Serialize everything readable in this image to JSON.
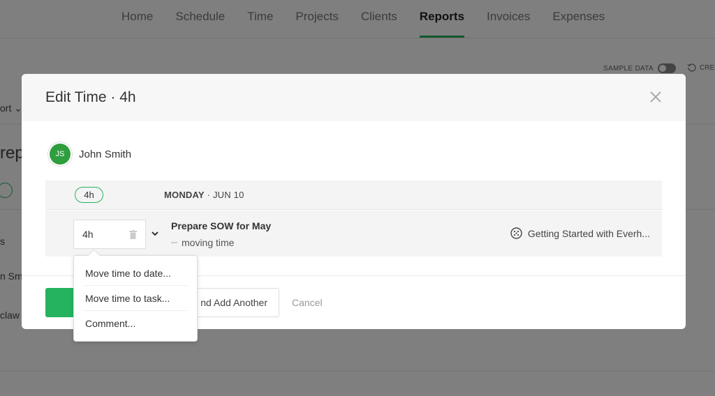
{
  "background": {
    "nav": [
      "Home",
      "Schedule",
      "Time",
      "Projects",
      "Clients",
      "Reports",
      "Invoices",
      "Expenses"
    ],
    "active_nav": "Reports",
    "sample_data_label": "SAMPLE DATA",
    "cre_label": "CRE",
    "sort_label": "ort",
    "heading_fragment": "rep",
    "col_fragment": "s",
    "row1_fragment": "n Sm",
    "row2_fragment": "claw"
  },
  "modal": {
    "title": "Edit Time · 4h",
    "user": {
      "initials": "JS",
      "name": "John Smith"
    },
    "day": {
      "hours": "4h",
      "weekday": "MONDAY",
      "date": "· JUN 10"
    },
    "entry": {
      "time_value": "4h",
      "task_name": "Prepare SOW for May",
      "note": "moving time",
      "project": "Getting Started with Everh..."
    },
    "footer": {
      "add_another_label": "nd Add Another",
      "cancel_label": "Cancel"
    }
  },
  "menu": {
    "items": [
      "Move time to date...",
      "Move time to task...",
      "Comment..."
    ]
  },
  "colors": {
    "accent": "#25b35f",
    "avatar": "#2e9e3e"
  }
}
